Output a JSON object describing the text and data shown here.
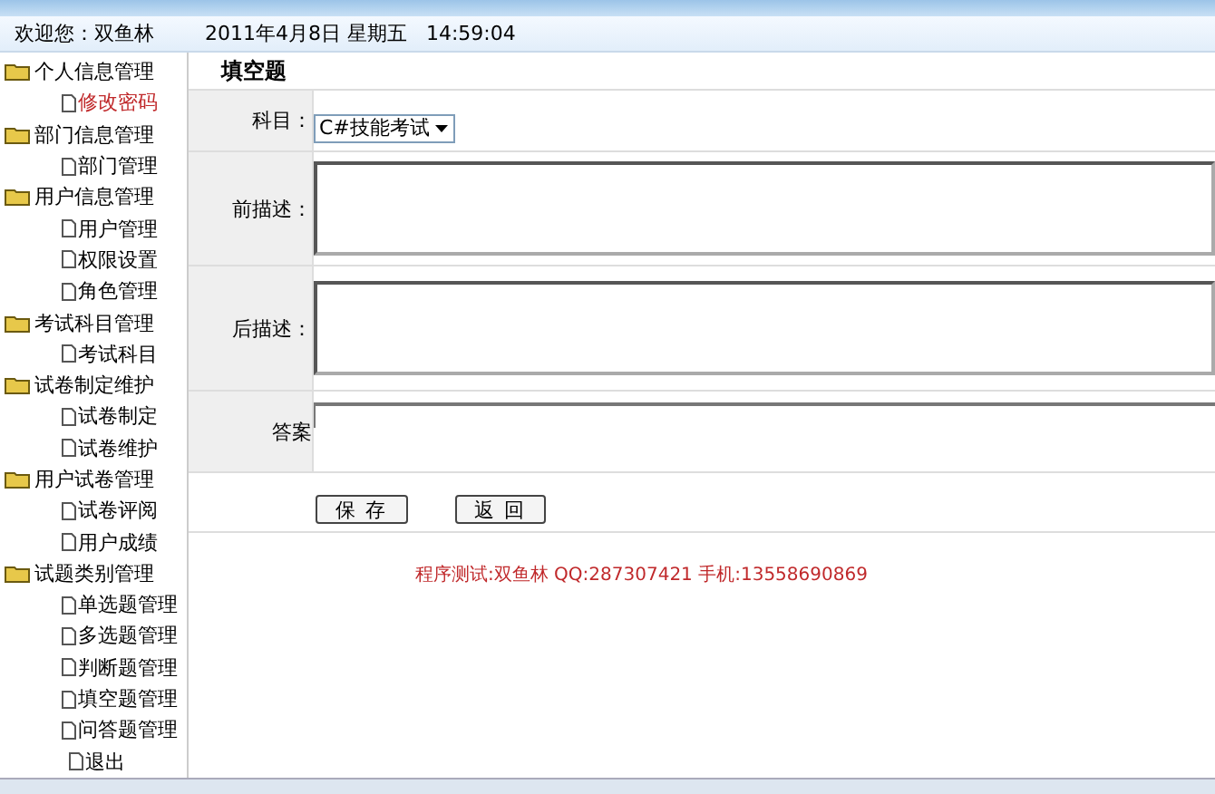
{
  "header": {
    "welcome": "欢迎您：双鱼林",
    "datetime": "2011年4月8日 星期五   14:59:04"
  },
  "sidebar": {
    "items": [
      {
        "label": "个人信息管理",
        "children": [
          {
            "label": "修改密码",
            "selected": true
          }
        ]
      },
      {
        "label": "部门信息管理",
        "children": [
          {
            "label": "部门管理",
            "selected": false
          }
        ]
      },
      {
        "label": "用户信息管理",
        "children": [
          {
            "label": "用户管理",
            "selected": false
          },
          {
            "label": "权限设置",
            "selected": false
          },
          {
            "label": "角色管理",
            "selected": false
          }
        ]
      },
      {
        "label": "考试科目管理",
        "children": [
          {
            "label": "考试科目",
            "selected": false
          }
        ]
      },
      {
        "label": "试卷制定维护",
        "children": [
          {
            "label": "试卷制定",
            "selected": false
          },
          {
            "label": "试卷维护",
            "selected": false
          }
        ]
      },
      {
        "label": "用户试卷管理",
        "children": [
          {
            "label": "试卷评阅",
            "selected": false
          },
          {
            "label": "用户成绩",
            "selected": false
          }
        ]
      },
      {
        "label": "试题类别管理",
        "children": [
          {
            "label": "单选题管理",
            "selected": false
          },
          {
            "label": "多选题管理",
            "selected": false
          },
          {
            "label": "判断题管理",
            "selected": false
          },
          {
            "label": "填空题管理",
            "selected": false
          },
          {
            "label": "问答题管理",
            "selected": false
          }
        ]
      },
      {
        "label": "退出",
        "selected": false
      }
    ]
  },
  "form": {
    "title": "填空题",
    "fields": [
      {
        "kind": "select",
        "label": "科目：",
        "value": "C#技能考试"
      },
      {
        "kind": "textarea",
        "label": "前描述："
      },
      {
        "kind": "textarea",
        "label": "后描述："
      },
      {
        "kind": "text",
        "label": "答案"
      }
    ],
    "buttons": [
      "保 存",
      "返 回"
    ]
  },
  "footer": "程序测试:双鱼林 QQ:287307421 手机:13558690869"
}
